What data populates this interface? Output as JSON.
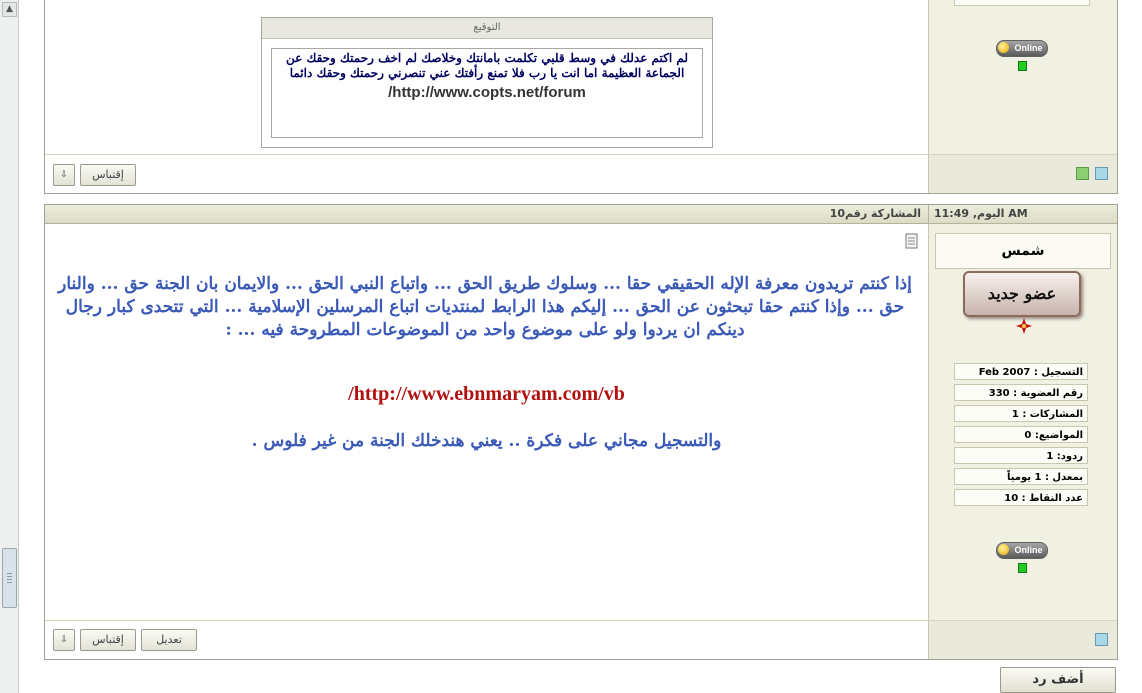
{
  "post1": {
    "signature_title": "التوقيع",
    "signature_text": "لم اكتم عدلك في وسط قلبي تكلمت بامانتك وخلاصك لم اخف رحمتك وحقك عن الجماعة العظيمة اما انت يا رب فلا تمنع رأفتك عني تنصرني رحمتك وحقك دائما",
    "signature_link": "/http://www.copts.net/forum",
    "quote_button": "إقتباس",
    "online_label": "Online"
  },
  "post2": {
    "date": "اليوم, 11:49 AM",
    "post_number": "المشاركة رقم10",
    "body_line1": "إذا كنتم تريدون معرفة الإله الحقيقي حقا ... وسلوك طريق الحق ... واتباع النبي الحق ... والايمان بان الجنة حق ... والنار حق ... وإذا كنتم حقا تبحثون عن الحق ... إليكم هذا الرابط لمنتديات اتباع المرسلين الإسلامية ... التي تتحدى كبار رجال دينكم ان يردوا ولو على موضوع واحد من الموضوعات المطروحة فيه ... :",
    "link": "/http://www.ebnmaryam.com/vb",
    "body_end": "والتسجيل مجاني على فكرة .. يعني هندخلك الجنة من غير فلوس .",
    "username": "شمس",
    "rank_label": "عضو جديد",
    "online_label": "Online",
    "stats": [
      "التسجيل : Feb 2007",
      "رقم العضوية : 330",
      "المشاركات : 1",
      "المواضيع: 0",
      "ردود: 1",
      "بمعدل : 1 يومياً",
      "عدد النقاط : 10"
    ],
    "edit_button": "تعديل",
    "quote_button": "إقتباس"
  },
  "reply_button": "أضف رد",
  "colors": {
    "body_text": "#3b59b6",
    "link": "#b01010",
    "signature_text": "#000060",
    "user_pane": "#f1f1e3"
  }
}
